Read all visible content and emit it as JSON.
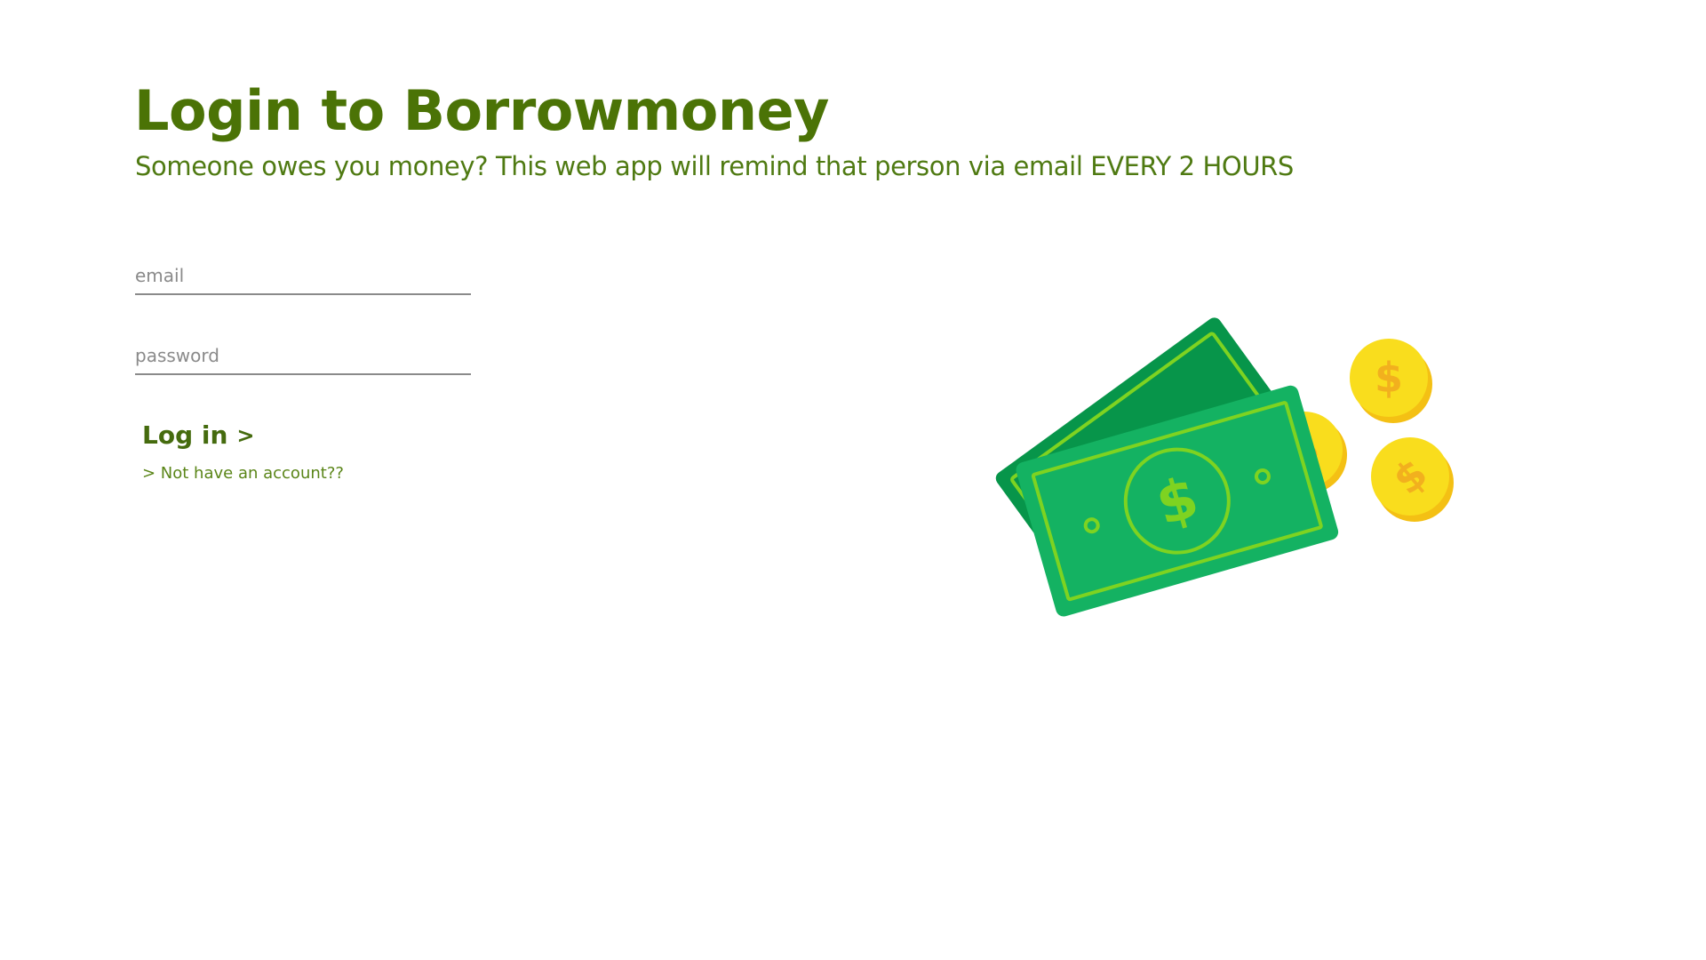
{
  "page": {
    "title": "Login to Borrowmoney",
    "subtitle": "Someone owes you money? This web app will remind that person via email EVERY 2 HOURS"
  },
  "form": {
    "email": {
      "value": "",
      "placeholder": "email"
    },
    "password": {
      "value": "",
      "placeholder": "password"
    },
    "login_label": "Log in",
    "login_chevron": ">",
    "signup_link": "> Not have an account??"
  },
  "illustration": {
    "icon": "money-bills-and-coins-icon",
    "bill_symbol": "$",
    "coin_symbol": "$"
  },
  "colors": {
    "title": "#4b7306",
    "subtitle": "#4f7a12",
    "bill_dark": "#07954a",
    "bill_light": "#14b262",
    "bill_line": "#7ed321",
    "coin_face": "#f9dd1d",
    "coin_edge": "#f4c014",
    "coin_symbol": "#f2b01e"
  }
}
